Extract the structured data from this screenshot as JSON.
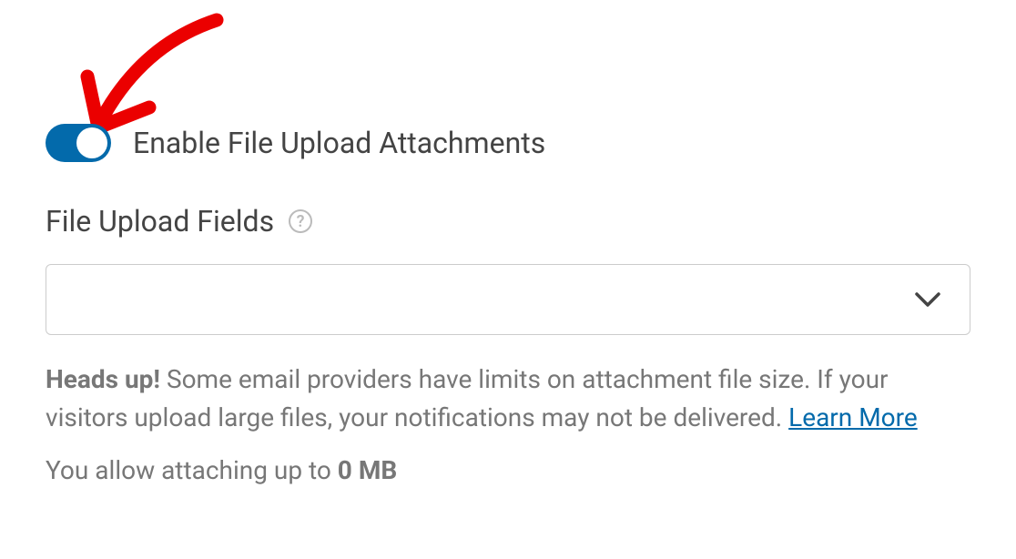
{
  "toggle": {
    "label": "Enable File Upload Attachments",
    "enabled": true
  },
  "section": {
    "label": "File Upload Fields"
  },
  "select": {
    "value": ""
  },
  "warning": {
    "prefix": "Heads up!",
    "body": " Some email providers have limits on attachment file size. If your visitors upload large files, your notifications may not be delivered. ",
    "link_text": "Learn More"
  },
  "allow": {
    "prefix": "You allow attaching up to ",
    "size": "0 MB"
  }
}
